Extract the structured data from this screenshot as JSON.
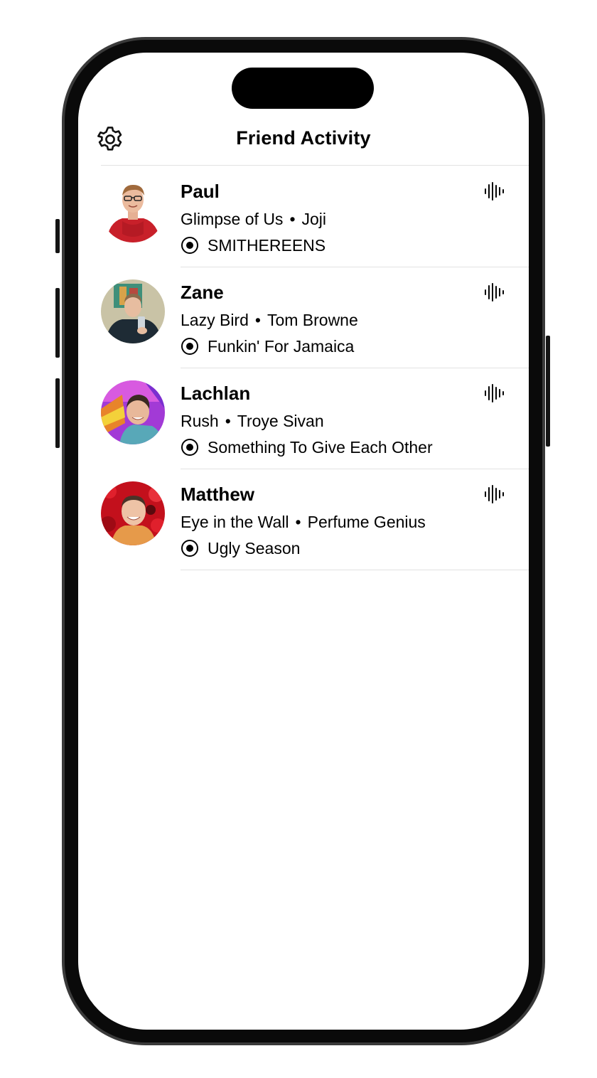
{
  "header": {
    "title": "Friend Activity",
    "settings_icon": "gear-icon"
  },
  "friends": [
    {
      "name": "Paul",
      "track": "Glimpse of Us",
      "artist": "Joji",
      "context": "SMITHEREENS",
      "context_icon": "album-icon",
      "activity_icon": "waveform-icon",
      "avatar": "avatar-photo"
    },
    {
      "name": "Zane",
      "track": "Lazy Bird",
      "artist": "Tom Browne",
      "context": "Funkin' For Jamaica",
      "context_icon": "album-icon",
      "activity_icon": "waveform-icon",
      "avatar": "avatar-photo"
    },
    {
      "name": "Lachlan",
      "track": "Rush",
      "artist": "Troye Sivan",
      "context": "Something To Give Each Other",
      "context_icon": "album-icon",
      "activity_icon": "waveform-icon",
      "avatar": "avatar-photo"
    },
    {
      "name": "Matthew",
      "track": "Eye in the Wall",
      "artist": "Perfume Genius",
      "context": "Ugly Season",
      "context_icon": "album-icon",
      "activity_icon": "waveform-icon",
      "avatar": "avatar-photo"
    }
  ],
  "separator": "•",
  "colors": {
    "background": "#ffffff",
    "text": "#000000",
    "separator": "#e2e2e2",
    "device_frame": "#0a0a0a"
  }
}
